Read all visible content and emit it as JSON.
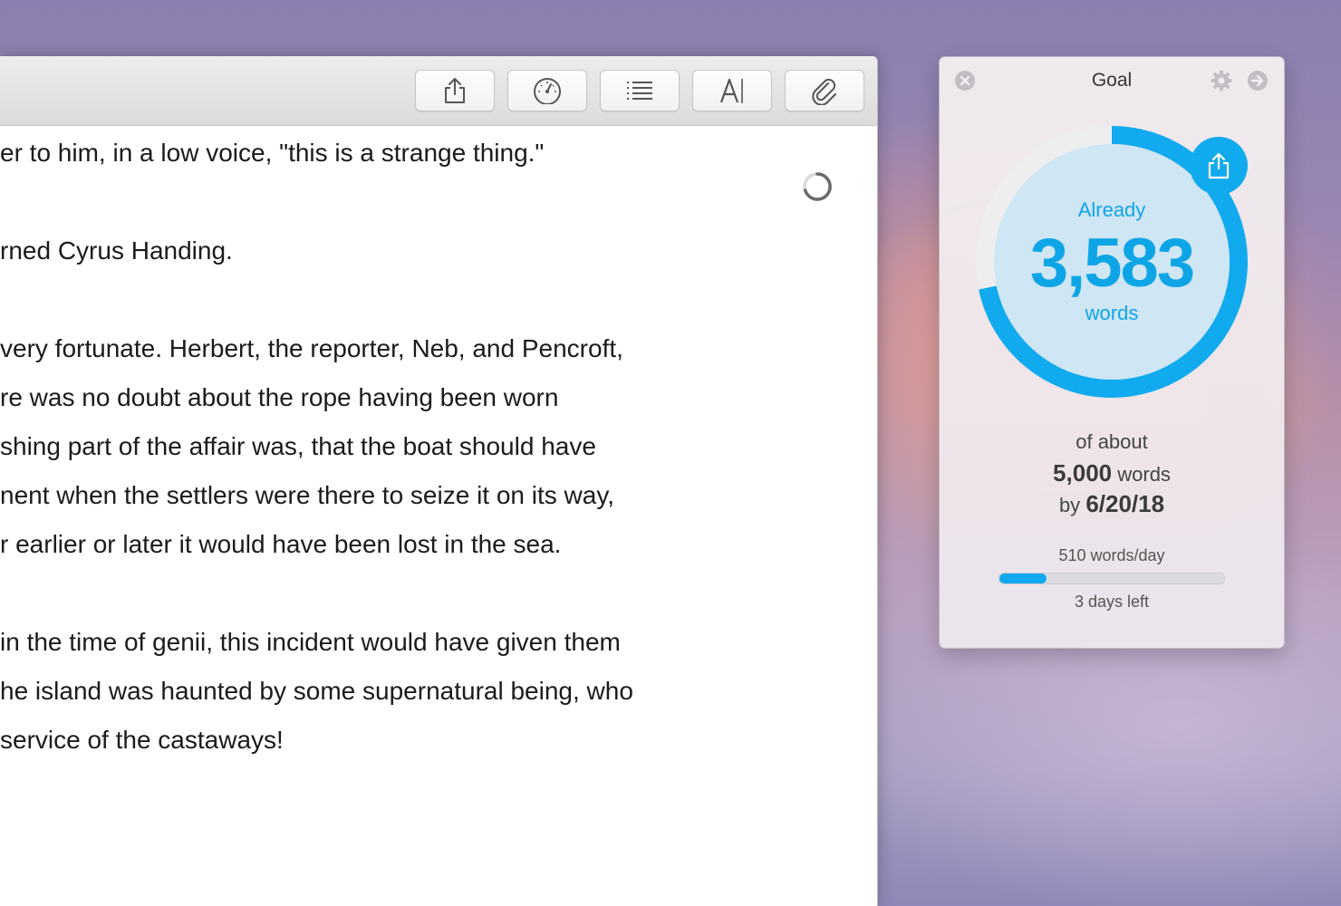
{
  "editor": {
    "toolbar": {
      "buttons": [
        {
          "name": "share",
          "icon": "share-icon"
        },
        {
          "name": "stats",
          "icon": "speedometer-icon"
        },
        {
          "name": "outline",
          "icon": "list-icon"
        },
        {
          "name": "typography",
          "icon": "font-icon"
        },
        {
          "name": "attachments",
          "icon": "paperclip-icon"
        }
      ]
    },
    "lines": [
      "er to him, in a low voice, \"this is a strange thing.\"",
      "",
      "rned Cyrus Handing.",
      "",
      "very fortunate. Herbert, the reporter, Neb, and Pencroft,",
      "re was no doubt about the rope having been worn",
      "shing part of the affair was, that the boat should have",
      "nent when the settlers were there to seize it on its way,",
      "r earlier or later it would have been lost in the sea.",
      "",
      "in the time of genii, this incident would have given them",
      "he island was haunted by some supernatural being, who",
      "service of the castaways!"
    ]
  },
  "goal": {
    "title": "Goal",
    "already_label": "Already",
    "count": "3,583",
    "count_unit": "words",
    "of_about": "of about",
    "target_value": "5,000",
    "target_unit": "words",
    "by_label": "by",
    "deadline": "6/20/18",
    "per_day": "510 words/day",
    "days_left": "3 days left",
    "progress_fraction": 0.717,
    "day_progress_fraction": 0.21,
    "accent_color": "#11aaee"
  }
}
